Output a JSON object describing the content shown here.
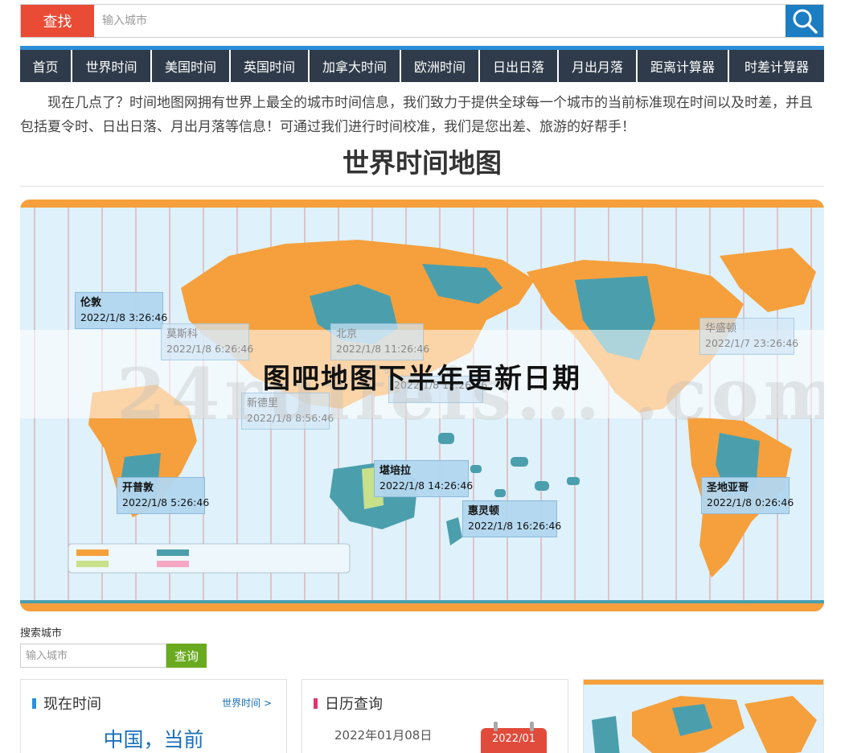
{
  "topbar": {
    "find_label": "查找",
    "placeholder": "输入城市",
    "search_icon": "magnifier-icon"
  },
  "nav": {
    "items": [
      "首页",
      "世界时间",
      "美国时间",
      "英国时间",
      "加拿大时间",
      "欧洲时间",
      "日出日落",
      "月出月落",
      "距离计算器",
      "时差计算器"
    ]
  },
  "intro": "现在几点了？时间地图网拥有世界上最全的城市时间信息，我们致力于提供全球每一个城市的当前标准现在时间以及时差，并且包括夏令时、日出日落、月出月落等信息！可通过我们进行时间校准，我们是您出差、旅游的好帮手！",
  "page_title": "世界时间地图",
  "map": {
    "overlay_title": "图吧地图下半年更新日期",
    "watermark": "24ruifeis... .com",
    "cities": [
      {
        "name": "伦敦",
        "time": "2022/1/8 3:26:46"
      },
      {
        "name": "莫斯科",
        "time": "2022/1/8 6:26:46"
      },
      {
        "name": "北京",
        "time": "2022/1/8 11:26:46"
      },
      {
        "name": "华盛顿",
        "time": "2022/1/7 23:26:46"
      },
      {
        "name": "东京",
        "time": "2022/1/8 12:26:46"
      },
      {
        "name": "新德里",
        "time": "2022/1/8 8:56:46"
      },
      {
        "name": "开普敦",
        "time": "2022/1/8 5:26:46"
      },
      {
        "name": "堪培拉",
        "time": "2022/1/8 14:26:46"
      },
      {
        "name": "惠灵顿",
        "time": "2022/1/8 16:26:46"
      },
      {
        "name": "圣地亚哥",
        "time": "2022/1/8 0:26:46"
      }
    ],
    "colors": {
      "ocean": "#dff1fb",
      "orange_zone": "#f5a03c",
      "teal_zone": "#4b9fad",
      "zone_line": "#d9534f"
    }
  },
  "search": {
    "label": "搜索城市",
    "placeholder": "输入城市",
    "button": "查询"
  },
  "panels": {
    "now": {
      "title": "现在时间",
      "more": "世界时间 >",
      "city": "中国，当前"
    },
    "calendar": {
      "title": "日历查询",
      "date": "2022年01月08日",
      "icon_label": "2022/01"
    }
  }
}
